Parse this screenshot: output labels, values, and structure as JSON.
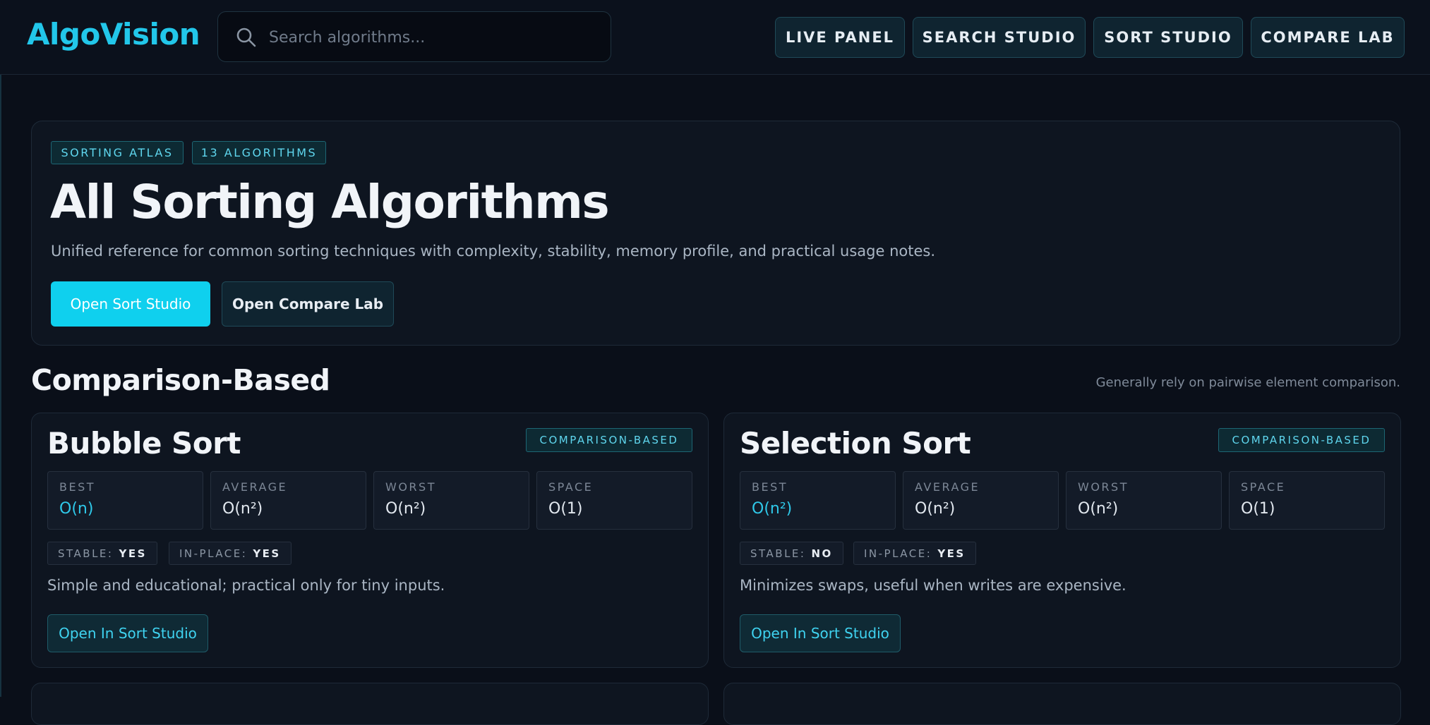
{
  "header": {
    "logo": "AlgoVision",
    "search_placeholder": "Search algorithms...",
    "nav": [
      "LIVE PANEL",
      "SEARCH STUDIO",
      "SORT STUDIO",
      "COMPARE LAB"
    ]
  },
  "hero": {
    "tags": [
      "SORTING ATLAS",
      "13 ALGORITHMS"
    ],
    "title": "All Sorting Algorithms",
    "description": "Unified reference for common sorting techniques with complexity, stability, memory profile, and practical usage notes.",
    "primary_button": "Open Sort Studio",
    "secondary_button": "Open Compare Lab"
  },
  "section": {
    "title": "Comparison-Based",
    "note": "Generally rely on pairwise element comparison."
  },
  "cards": [
    {
      "title": "Bubble Sort",
      "badge": "COMPARISON-BASED",
      "metrics": [
        {
          "label": "BEST",
          "value": "O(n)"
        },
        {
          "label": "AVERAGE",
          "value": "O(n²)"
        },
        {
          "label": "WORST",
          "value": "O(n²)"
        },
        {
          "label": "SPACE",
          "value": "O(1)"
        }
      ],
      "stable_label": "STABLE:",
      "stable_value": "YES",
      "inplace_label": "IN-PLACE:",
      "inplace_value": "YES",
      "description": "Simple and educational; practical only for tiny inputs.",
      "button": "Open In Sort Studio"
    },
    {
      "title": "Selection Sort",
      "badge": "COMPARISON-BASED",
      "metrics": [
        {
          "label": "BEST",
          "value": "O(n²)"
        },
        {
          "label": "AVERAGE",
          "value": "O(n²)"
        },
        {
          "label": "WORST",
          "value": "O(n²)"
        },
        {
          "label": "SPACE",
          "value": "O(1)"
        }
      ],
      "stable_label": "STABLE:",
      "stable_value": "NO",
      "inplace_label": "IN-PLACE:",
      "inplace_value": "YES",
      "description": "Minimizes swaps, useful when writes are expensive.",
      "button": "Open In Sort Studio"
    }
  ],
  "colors": {
    "background": "#0a0f19",
    "accent": "#0fd0ee",
    "panel": "#0e1520"
  }
}
